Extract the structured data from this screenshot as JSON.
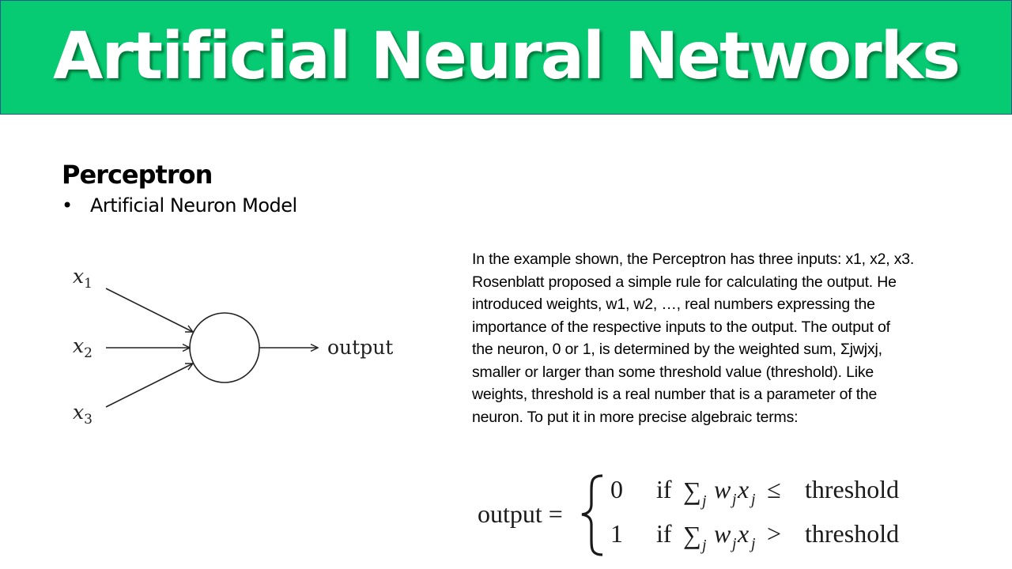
{
  "slide": {
    "title": "Artificial Neural Networks",
    "colors": {
      "banner": "#07cb73",
      "banner_border": "#1f5a8a",
      "text": "#000000"
    }
  },
  "section": {
    "heading": "Perceptron",
    "bullets": [
      {
        "marker": "•",
        "text": "Artificial Neuron Model"
      }
    ]
  },
  "diagram": {
    "inputs": [
      {
        "var": "x",
        "sub": "1"
      },
      {
        "var": "x",
        "sub": "2"
      },
      {
        "var": "x",
        "sub": "3"
      }
    ],
    "output_label": "output"
  },
  "paragraph": {
    "lines": [
      "In the example shown, the Perceptron has three inputs: x1, x2, x3.",
      "Rosenblatt proposed a simple rule for calculating the output. He",
      "introduced weights, w1, w2, …, real numbers expressing the",
      "importance of the respective inputs to the output. The output of",
      "the neuron, 0 or 1, is determined by the weighted sum, Σjwjxj,",
      "smaller or larger than some threshold value (threshold). Like",
      "weights, threshold is a real number that is a parameter of the",
      "neuron. To put it in more precise algebraic terms:"
    ]
  },
  "formula": {
    "lhs": "output =",
    "cases": [
      {
        "value": "0",
        "condition": "if",
        "sum": "∑",
        "sum_sub": "j",
        "term_w": "w",
        "term_x": "x",
        "idx": "j",
        "op": "≤",
        "rhs": "threshold"
      },
      {
        "value": "1",
        "condition": "if",
        "sum": "∑",
        "sum_sub": "j",
        "term_w": "w",
        "term_x": "x",
        "idx": "j",
        "op": ">",
        "rhs": "threshold"
      }
    ]
  }
}
